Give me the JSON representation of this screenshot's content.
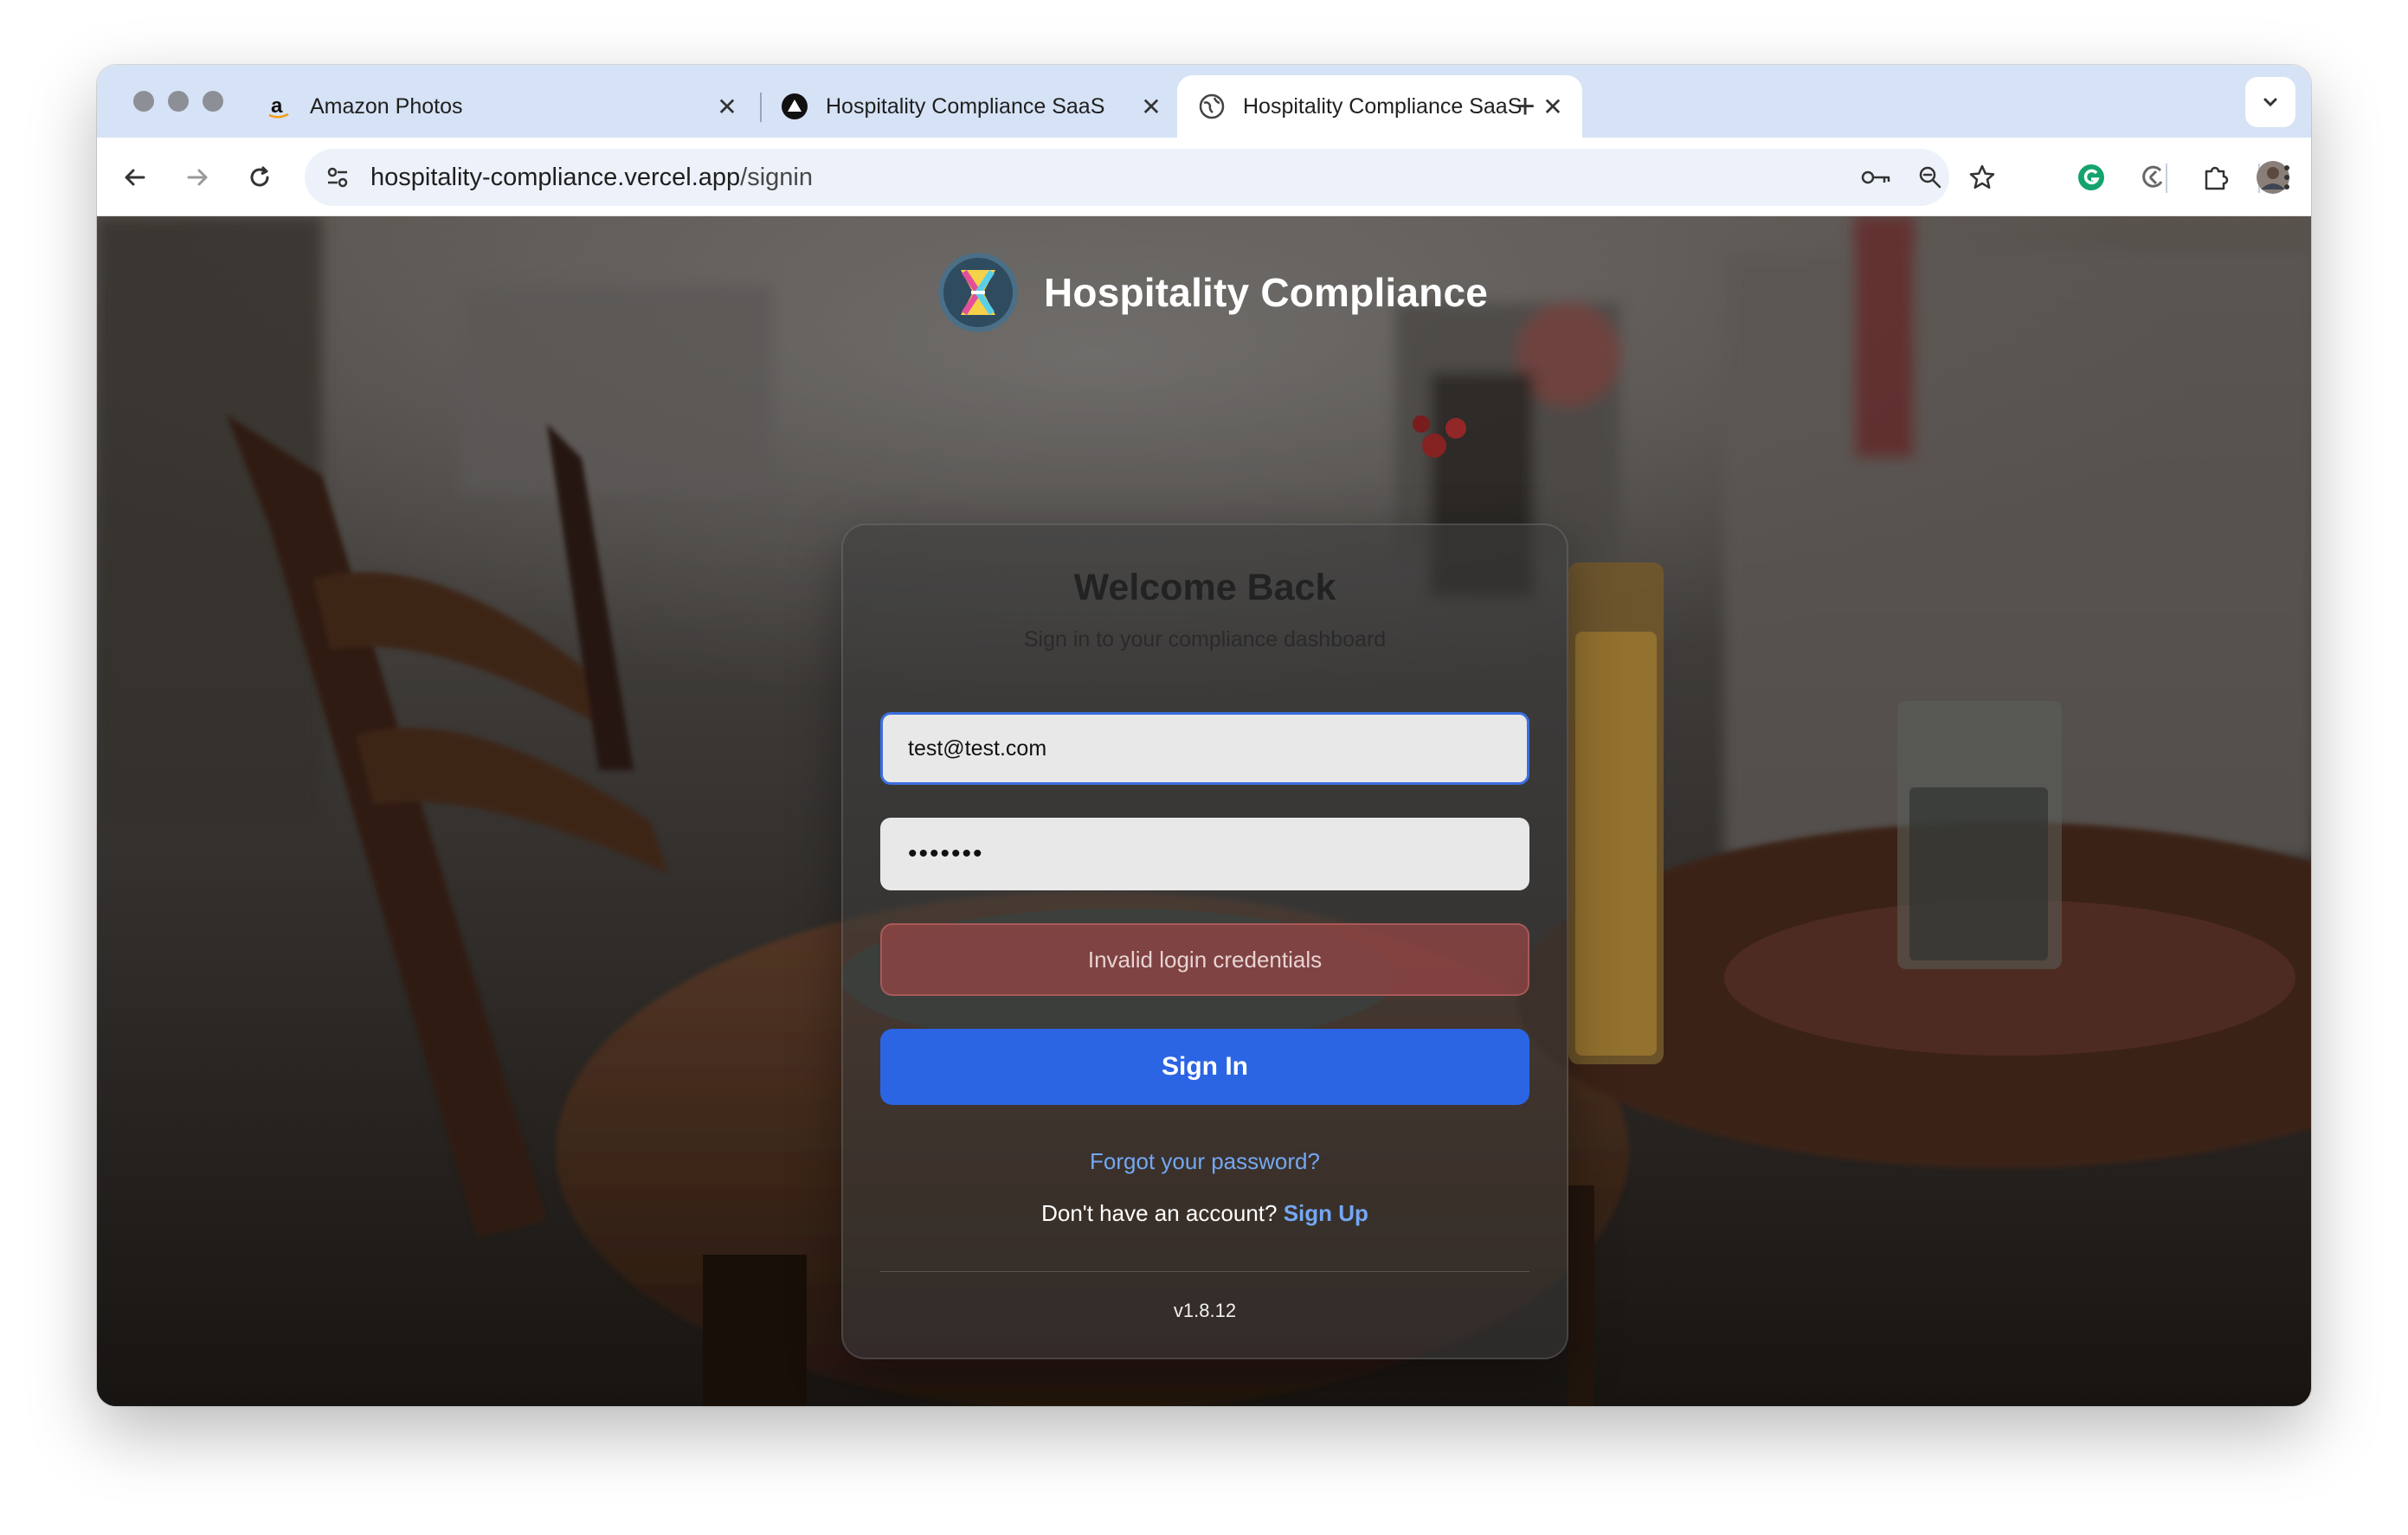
{
  "browser": {
    "tabs": [
      {
        "title": "Amazon Photos",
        "icon": "amazon-icon",
        "active": false
      },
      {
        "title": "Hospitality Compliance SaaS",
        "icon": "vercel-triangle-icon",
        "active": false
      },
      {
        "title": "Hospitality Compliance SaaS",
        "icon": "globe-icon",
        "active": true
      }
    ],
    "url": {
      "host": "hospitality-compliance.vercel.app",
      "path": "/signin"
    }
  },
  "brand": {
    "name": "Hospitality Compliance"
  },
  "signin": {
    "title": "Welcome Back",
    "subtitle": "Sign in to your compliance dashboard",
    "email_value": "test@test.com",
    "password_value": "•••••••",
    "error": "Invalid login credentials",
    "submit_label": "Sign In",
    "forgot_label": "Forgot your password?",
    "no_account_text": "Don't have an account?",
    "signup_label": "Sign Up",
    "version": "v1.8.12"
  },
  "colors": {
    "primary_button": "#2b65e3",
    "link": "#73a8f3",
    "error_bg": "#964646",
    "tabstrip": "#d6e2f5"
  }
}
